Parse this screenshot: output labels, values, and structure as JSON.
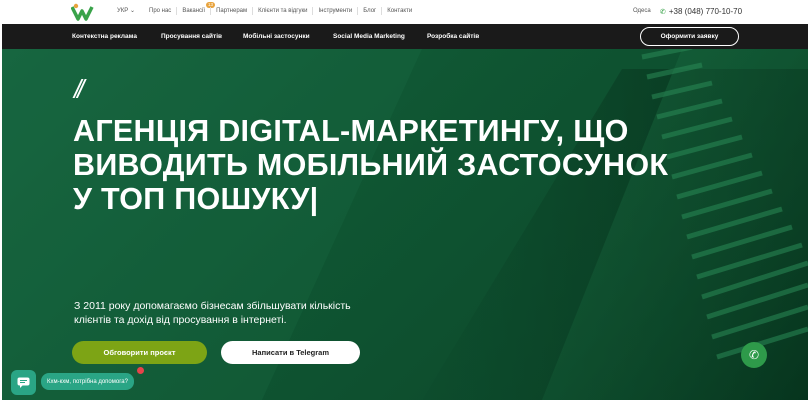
{
  "topbar": {
    "lang": "УКР",
    "nav": [
      {
        "label": "Про нас"
      },
      {
        "label": "Вакансії",
        "badge": "13"
      },
      {
        "label": "Партнерам"
      },
      {
        "label": "Клієнти та відгуки"
      },
      {
        "label": "Інструменти"
      },
      {
        "label": "Блог"
      },
      {
        "label": "Контакти"
      }
    ],
    "city": "Одеса",
    "phone": "+38 (048) 770-10-70"
  },
  "navbar": {
    "links": [
      "Контекстна реклама",
      "Просування сайтів",
      "Мобільні застосунки",
      "Social Media Marketing",
      "Розробка сайтів"
    ],
    "order_button": "Оформити заявку"
  },
  "hero": {
    "slashes": "//",
    "headline_lines": [
      "АГЕНЦІЯ DIGITAL-МАРКЕТИНГУ, ЩО",
      "ВИВОДИТЬ МОБІЛЬНИЙ ЗАСТОСУНОК",
      "У ТОП ПОШУКУ|"
    ],
    "subtitle": "З 2011 року допомагаємо бізнесам збільшувати кількість клієнтів та дохід від просування в інтернеті.",
    "primary_button": "Обговорити проєкт",
    "secondary_button": "Написати в Telegram"
  },
  "chat": {
    "bubble_text": "Кхм-кхм, потрібна допомога?"
  },
  "colors": {
    "hero_bg": "#0f5532",
    "accent_green": "#7da415",
    "navbar_bg": "#1a1a1a",
    "chat_teal": "#2aa585"
  }
}
